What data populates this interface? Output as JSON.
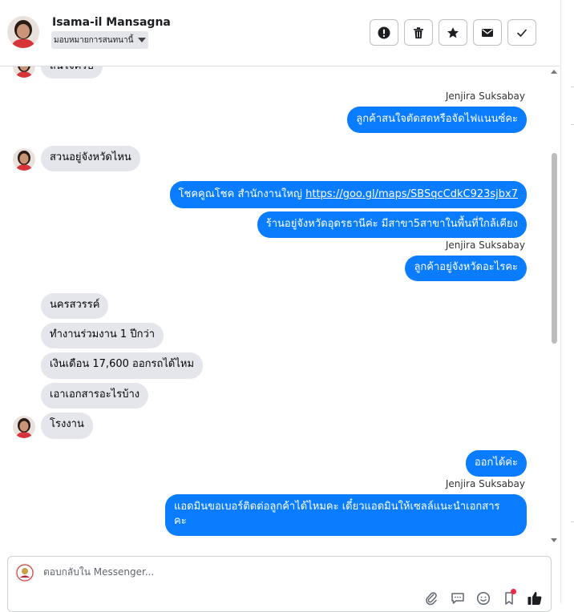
{
  "header": {
    "contact_name": "Isama-il Mansagna",
    "assign_label": "มอบหมายการสนทนานี้",
    "icons": [
      "alert-icon",
      "trash-icon",
      "star-icon",
      "envelope-icon",
      "check-icon"
    ]
  },
  "messages": {
    "m0": "สนใจครับ",
    "sender1": "Jenjira Suksabay",
    "m1": "ลูกค้าสนใจตัดสดหรือจัดไฟแนนซ์คะ",
    "m2": "สวนอยู่จังหวัดไหน",
    "m3_prefix": "โชคคูณโชค สำนักงานใหญ่",
    "m3_link": "https://goo.gl/maps/SBSqcCdkC923sjbx7",
    "m4": "ร้านอยู่จังหวัดอุดรธานีค่ะ มีสาขา5สาขาในพื้นที่ใกล้เคียง",
    "sender2": "Jenjira Suksabay",
    "m5": "ลูกค้าอยู่จังหวัดอะไรคะ",
    "m6": "นครสวรรค์",
    "m7": "ทำงานร่วมงาน 1 ปีกว่า",
    "m8": "เงินเดือน 17,600 ออกรถได้ไหม",
    "m9": "เอาเอกสารอะไรบ้าง",
    "m10": "โรงงาน",
    "m11": "ออกได้ค่ะ",
    "sender3": "Jenjira Suksabay",
    "m12_line1": "แอดมินขอเบอร์ติดต่อลูกค้าได้ไหมคะ เดี๋ยวแอดมินให้เซลล์แนะนำเอกสาร",
    "m12_line2": "คะ"
  },
  "composer": {
    "placeholder": "ตอบกลับใน Messenger...",
    "icons": [
      "paperclip-icon",
      "chat-bubble-icon",
      "smiley-icon",
      "bookmark-icon",
      "thumbs-up-icon"
    ]
  },
  "colors": {
    "outgoing_bubble": "#0a7cff",
    "incoming_bubble": "#e4e6eb",
    "notification_dot": "#f02849"
  }
}
